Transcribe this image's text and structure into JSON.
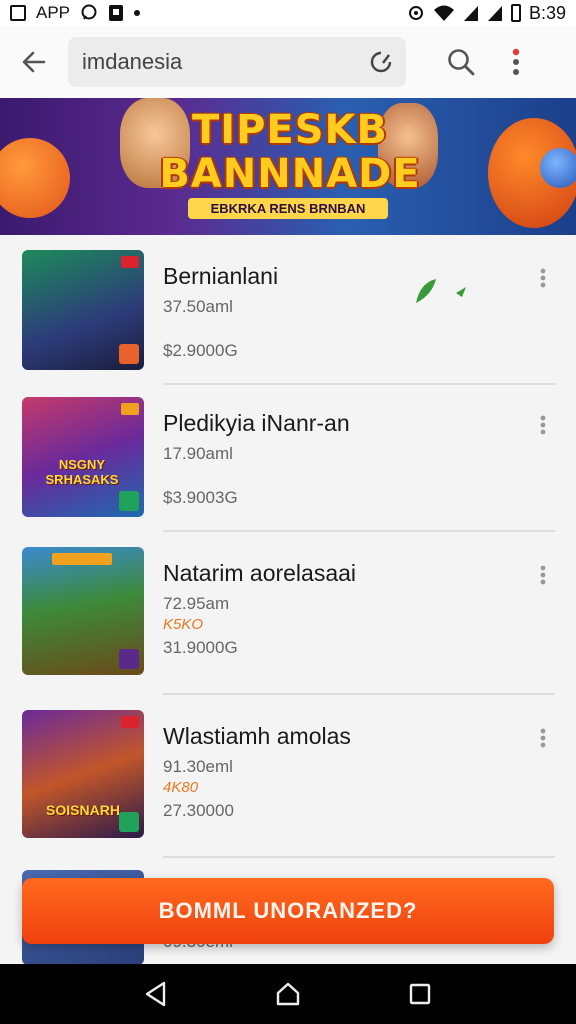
{
  "status_bar": {
    "app_label": "APP",
    "time": "B:39",
    "icons": [
      "image-icon",
      "chat-icon",
      "phone-icon",
      "dot-icon",
      "sync-icon",
      "wifi-icon",
      "signal-icon",
      "signal-icon",
      "battery-icon"
    ]
  },
  "app_bar": {
    "search_value": "imdanesia",
    "icons": [
      "back-arrow-icon",
      "edit-badge-icon",
      "search-icon",
      "more-vertical-icon"
    ],
    "more_dot_color": "#e53935"
  },
  "banner": {
    "title_line1": "TIPESKB",
    "title_line2": "BANNNADE",
    "subtitle": "EBKRKA RENS BRNBAN"
  },
  "items": [
    {
      "title": "Bernianlani",
      "line1": "37.50aml",
      "line2": "$2.9000G",
      "tag": ""
    },
    {
      "title": "Pledikyia iNanr-an",
      "line1": "17.90aml",
      "line2": "$3.9003G",
      "tag": ""
    },
    {
      "title": "Natarim aorelasaai",
      "line1": "72.95am",
      "line2": "31.9000G",
      "tag": "K5KO"
    },
    {
      "title": "Wlastiamh amolas",
      "line1": "91.30eml",
      "line2": "27.30000",
      "tag": "4K80"
    }
  ],
  "partial_item": {
    "line1": "09.30eml"
  },
  "thumb_labels": {
    "item2": "NSGNY SRHASAKS",
    "item4": "SOISNARH"
  },
  "cta": {
    "label": "BOMML UNORANZED?"
  },
  "nav_bar": {
    "icons": [
      "back-triangle-icon",
      "home-icon",
      "recents-square-icon"
    ]
  },
  "colors": {
    "accent": "#f0410e",
    "tag_orange": "#e8781f",
    "banner_gold": "#ffcc1f"
  }
}
